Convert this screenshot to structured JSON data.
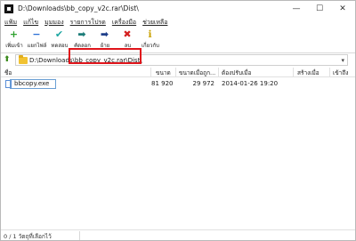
{
  "window": {
    "title": "D:\\Downloads\\bb_copy_v2c.rar\\Dist\\",
    "controls": {
      "minimize": "—",
      "maximize": "☐",
      "close": "✕"
    }
  },
  "menu": [
    "แฟ้ม",
    "แก้ไข",
    "มุมมอง",
    "รายการโปรด",
    "เครื่องมือ",
    "ช่วยเหลือ"
  ],
  "toolbar": {
    "add": "เพิ่มเข้า",
    "extract": "แยกไฟล์",
    "test": "ทดสอบ",
    "copy": "คัดลอก",
    "move": "ย้าย",
    "delete": "ลบ",
    "info": "เกี่ยวกับ"
  },
  "toolbar_icons": {
    "add": "plus-icon",
    "extract": "minus-icon",
    "test": "check-icon",
    "copy": "arrow-right-icon",
    "move": "arrow-right-icon",
    "delete": "x-icon",
    "info": "info-icon"
  },
  "colors": {
    "add": "#2ea12e",
    "extract": "#2a6fd6",
    "test": "#1ea7a2",
    "copy": "#1e7d7a",
    "move": "#1f3f8a",
    "delete": "#d42020",
    "info": "#c9a100",
    "highlight": "#e0151b"
  },
  "address": {
    "path": "D:\\Downloads\\bb_copy_v2c.rar\\Dist\\"
  },
  "columns": {
    "name": "ชื่อ",
    "size": "ขนาด",
    "packed": "ขนาดเมื่อถูก...",
    "modified": "ต้องปรับเมื่อ",
    "created": "สร้างเมื่อ",
    "accessed": "เข้าถึง"
  },
  "files": [
    {
      "name": "bbcopy.exe",
      "size": "81 920",
      "packed": "29 972",
      "modified": "2014-01-26 19:20"
    }
  ],
  "status": {
    "selection": "0 / 1 วัตถุที่เลือกไว้"
  }
}
